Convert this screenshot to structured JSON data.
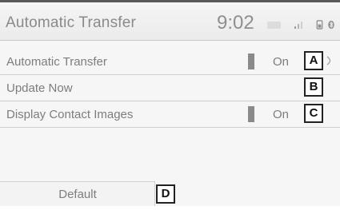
{
  "header": {
    "title": "Automatic Transfer",
    "clock": "9:02",
    "status_icons": [
      "badge-icon",
      "signal-icon",
      "phone-battery-icon",
      "bluetooth-icon"
    ]
  },
  "settings": [
    {
      "label": "Automatic Transfer",
      "value": "On",
      "callout": "A"
    },
    {
      "label": "Update Now",
      "value": "",
      "callout": "B"
    },
    {
      "label": "Display Contact Images",
      "value": "On",
      "callout": "C"
    }
  ],
  "footer": {
    "default_label": "Default",
    "callout": "D"
  }
}
